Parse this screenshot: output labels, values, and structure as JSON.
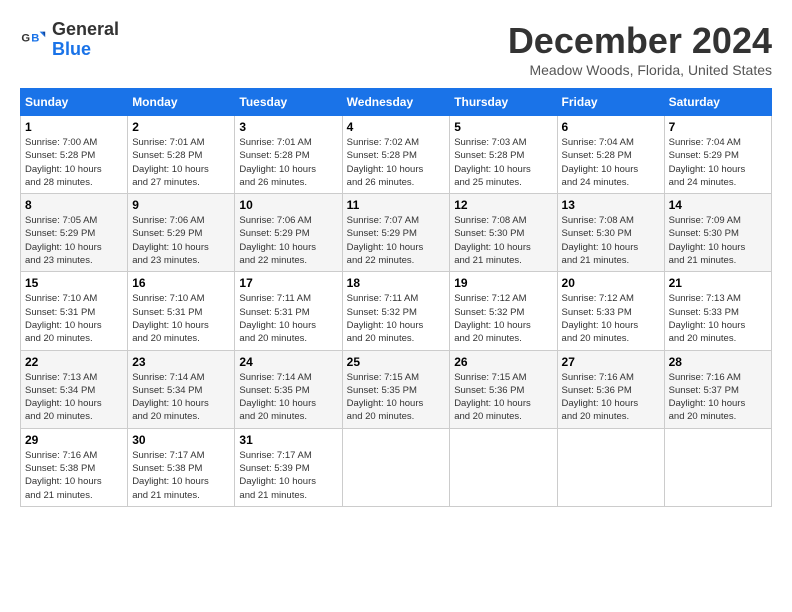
{
  "logo": {
    "line1": "General",
    "line2": "Blue"
  },
  "title": "December 2024",
  "location": "Meadow Woods, Florida, United States",
  "days_header": [
    "Sunday",
    "Monday",
    "Tuesday",
    "Wednesday",
    "Thursday",
    "Friday",
    "Saturday"
  ],
  "weeks": [
    [
      {
        "day": "1",
        "sunrise": "7:00 AM",
        "sunset": "5:28 PM",
        "daylight": "10 hours and 28 minutes."
      },
      {
        "day": "2",
        "sunrise": "7:01 AM",
        "sunset": "5:28 PM",
        "daylight": "10 hours and 27 minutes."
      },
      {
        "day": "3",
        "sunrise": "7:01 AM",
        "sunset": "5:28 PM",
        "daylight": "10 hours and 26 minutes."
      },
      {
        "day": "4",
        "sunrise": "7:02 AM",
        "sunset": "5:28 PM",
        "daylight": "10 hours and 26 minutes."
      },
      {
        "day": "5",
        "sunrise": "7:03 AM",
        "sunset": "5:28 PM",
        "daylight": "10 hours and 25 minutes."
      },
      {
        "day": "6",
        "sunrise": "7:04 AM",
        "sunset": "5:28 PM",
        "daylight": "10 hours and 24 minutes."
      },
      {
        "day": "7",
        "sunrise": "7:04 AM",
        "sunset": "5:29 PM",
        "daylight": "10 hours and 24 minutes."
      }
    ],
    [
      {
        "day": "8",
        "sunrise": "7:05 AM",
        "sunset": "5:29 PM",
        "daylight": "10 hours and 23 minutes."
      },
      {
        "day": "9",
        "sunrise": "7:06 AM",
        "sunset": "5:29 PM",
        "daylight": "10 hours and 23 minutes."
      },
      {
        "day": "10",
        "sunrise": "7:06 AM",
        "sunset": "5:29 PM",
        "daylight": "10 hours and 22 minutes."
      },
      {
        "day": "11",
        "sunrise": "7:07 AM",
        "sunset": "5:29 PM",
        "daylight": "10 hours and 22 minutes."
      },
      {
        "day": "12",
        "sunrise": "7:08 AM",
        "sunset": "5:30 PM",
        "daylight": "10 hours and 21 minutes."
      },
      {
        "day": "13",
        "sunrise": "7:08 AM",
        "sunset": "5:30 PM",
        "daylight": "10 hours and 21 minutes."
      },
      {
        "day": "14",
        "sunrise": "7:09 AM",
        "sunset": "5:30 PM",
        "daylight": "10 hours and 21 minutes."
      }
    ],
    [
      {
        "day": "15",
        "sunrise": "7:10 AM",
        "sunset": "5:31 PM",
        "daylight": "10 hours and 20 minutes."
      },
      {
        "day": "16",
        "sunrise": "7:10 AM",
        "sunset": "5:31 PM",
        "daylight": "10 hours and 20 minutes."
      },
      {
        "day": "17",
        "sunrise": "7:11 AM",
        "sunset": "5:31 PM",
        "daylight": "10 hours and 20 minutes."
      },
      {
        "day": "18",
        "sunrise": "7:11 AM",
        "sunset": "5:32 PM",
        "daylight": "10 hours and 20 minutes."
      },
      {
        "day": "19",
        "sunrise": "7:12 AM",
        "sunset": "5:32 PM",
        "daylight": "10 hours and 20 minutes."
      },
      {
        "day": "20",
        "sunrise": "7:12 AM",
        "sunset": "5:33 PM",
        "daylight": "10 hours and 20 minutes."
      },
      {
        "day": "21",
        "sunrise": "7:13 AM",
        "sunset": "5:33 PM",
        "daylight": "10 hours and 20 minutes."
      }
    ],
    [
      {
        "day": "22",
        "sunrise": "7:13 AM",
        "sunset": "5:34 PM",
        "daylight": "10 hours and 20 minutes."
      },
      {
        "day": "23",
        "sunrise": "7:14 AM",
        "sunset": "5:34 PM",
        "daylight": "10 hours and 20 minutes."
      },
      {
        "day": "24",
        "sunrise": "7:14 AM",
        "sunset": "5:35 PM",
        "daylight": "10 hours and 20 minutes."
      },
      {
        "day": "25",
        "sunrise": "7:15 AM",
        "sunset": "5:35 PM",
        "daylight": "10 hours and 20 minutes."
      },
      {
        "day": "26",
        "sunrise": "7:15 AM",
        "sunset": "5:36 PM",
        "daylight": "10 hours and 20 minutes."
      },
      {
        "day": "27",
        "sunrise": "7:16 AM",
        "sunset": "5:36 PM",
        "daylight": "10 hours and 20 minutes."
      },
      {
        "day": "28",
        "sunrise": "7:16 AM",
        "sunset": "5:37 PM",
        "daylight": "10 hours and 20 minutes."
      }
    ],
    [
      {
        "day": "29",
        "sunrise": "7:16 AM",
        "sunset": "5:38 PM",
        "daylight": "10 hours and 21 minutes."
      },
      {
        "day": "30",
        "sunrise": "7:17 AM",
        "sunset": "5:38 PM",
        "daylight": "10 hours and 21 minutes."
      },
      {
        "day": "31",
        "sunrise": "7:17 AM",
        "sunset": "5:39 PM",
        "daylight": "10 hours and 21 minutes."
      },
      null,
      null,
      null,
      null
    ]
  ]
}
